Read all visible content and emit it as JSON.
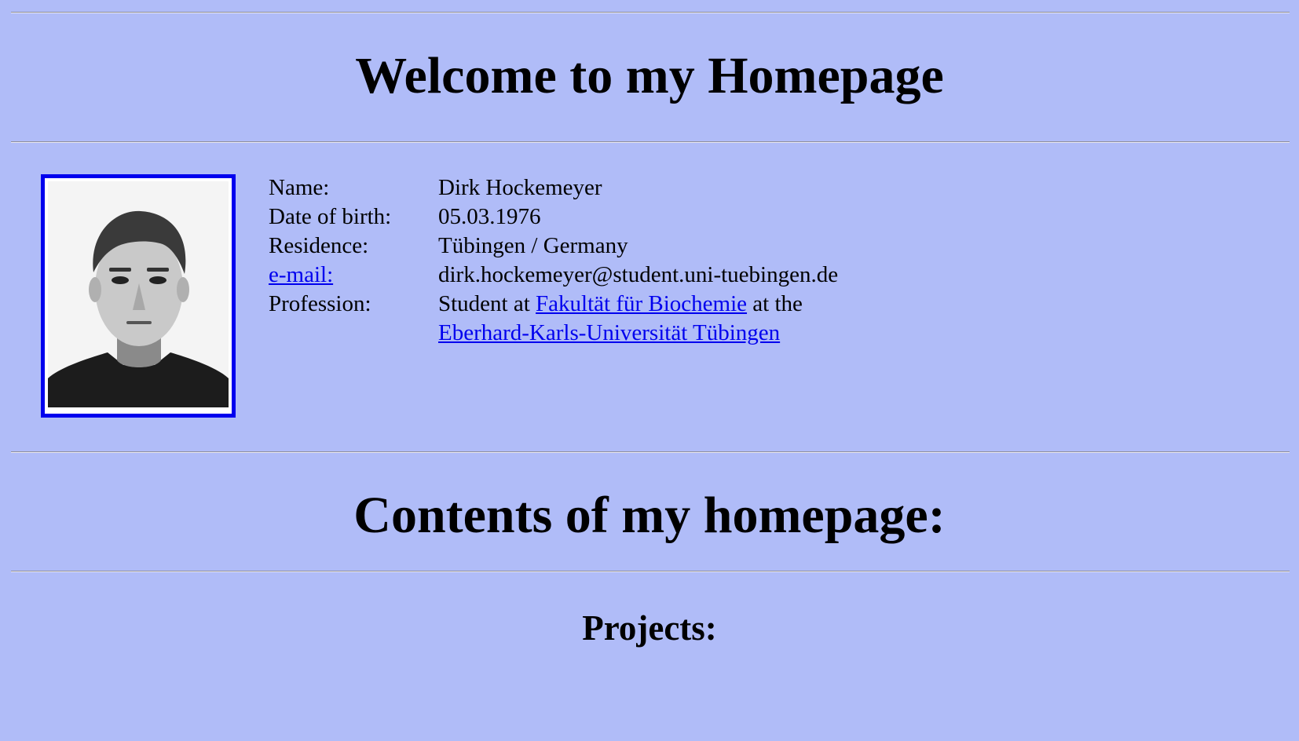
{
  "header": {
    "title": "Welcome to my Homepage"
  },
  "profile": {
    "photo_alt": "portrait photo",
    "name_label": "Name:",
    "name_value": "Dirk Hockemeyer",
    "dob_label": "Date of birth:",
    "dob_value": "05.03.1976",
    "residence_label": "Residence:",
    "residence_value": "Tübingen / Germany",
    "email_label": "e-mail:",
    "email_value": "dirk.hockemeyer@student.uni-tuebingen.de",
    "profession_label": "Profession:",
    "profession_prefix": "Student at ",
    "faculty_link": "Fakultät für Biochemie",
    "profession_middle": " at the",
    "university_link": "Eberhard-Karls-Universität Tübingen"
  },
  "contents": {
    "title": "Contents of my homepage:",
    "projects_heading": "Projects:"
  },
  "colors": {
    "background": "#b0bcf8",
    "link": "#0000ee",
    "photo_border": "#0000ee"
  }
}
